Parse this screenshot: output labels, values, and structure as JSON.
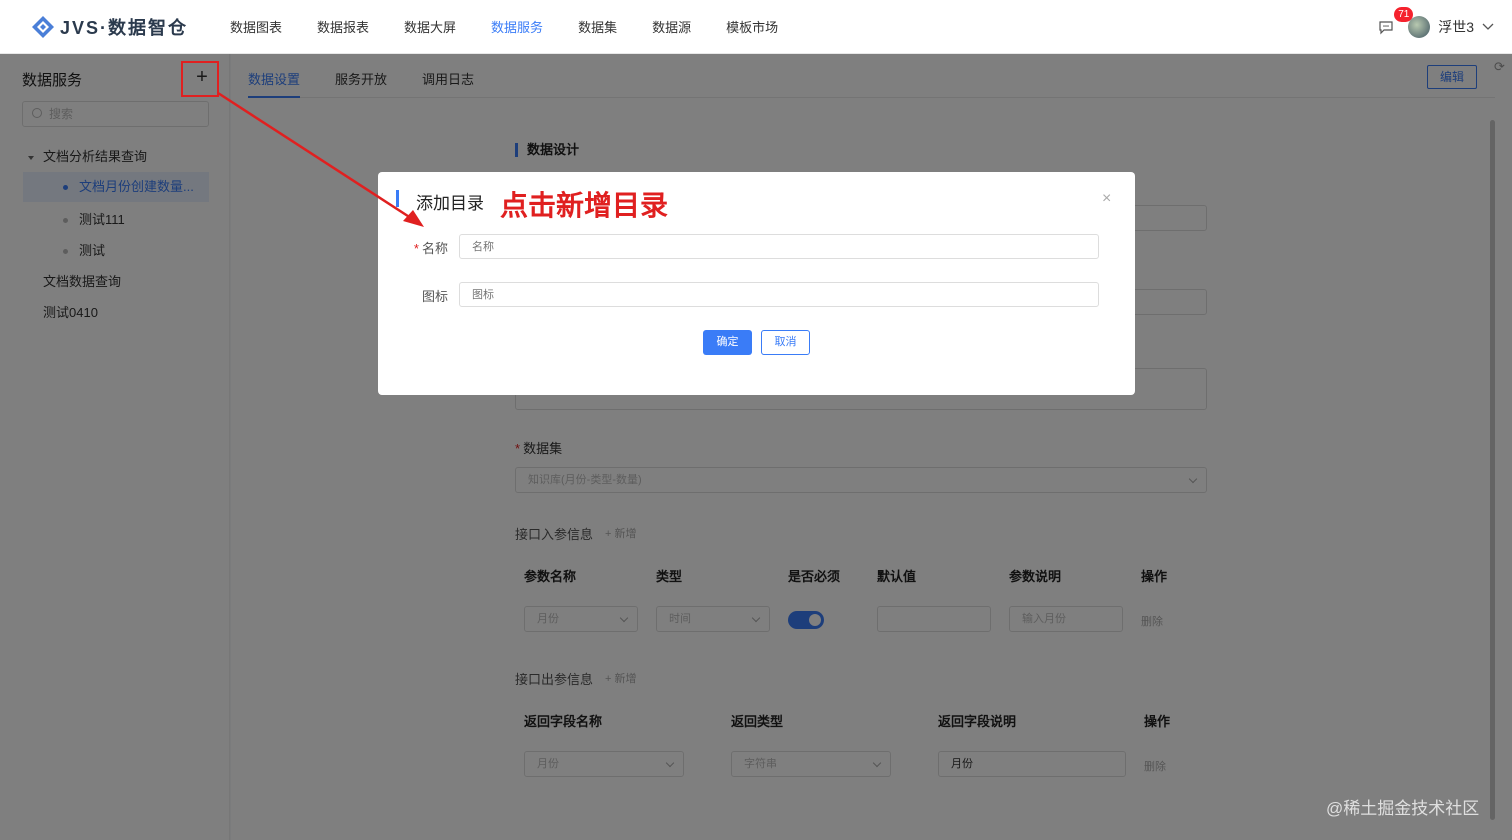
{
  "app": {
    "logo_text": "JVS·数据智仓"
  },
  "nav": {
    "items": [
      {
        "label": "数据图表",
        "active": false
      },
      {
        "label": "数据报表",
        "active": false
      },
      {
        "label": "数据大屏",
        "active": false
      },
      {
        "label": "数据服务",
        "active": true
      },
      {
        "label": "数据集",
        "active": false
      },
      {
        "label": "数据源",
        "active": false
      },
      {
        "label": "模板市场",
        "active": false
      }
    ]
  },
  "header": {
    "badge_count": "71",
    "username": "浮世3"
  },
  "sidebar": {
    "title": "数据服务",
    "add_label": "+",
    "search_placeholder": "搜索",
    "tree": [
      {
        "label": "文档分析结果查询"
      },
      {
        "label": "文档月份创建数量..."
      },
      {
        "label": "测试111"
      },
      {
        "label": "测试"
      },
      {
        "label": "文档数据查询"
      },
      {
        "label": "测试0410"
      }
    ]
  },
  "tabs": [
    {
      "label": "数据设置",
      "active": true
    },
    {
      "label": "服务开放",
      "active": false
    },
    {
      "label": "调用日志",
      "active": false
    }
  ],
  "toolbar": {
    "edit_label": "编辑"
  },
  "form": {
    "section_title": "数据设计",
    "dataset_label": "数据集",
    "dataset_value": "知识库(月份-类型-数量)",
    "input_params_label": "接口入参信息",
    "add_label": "+ 新增",
    "input_columns": [
      "参数名称",
      "类型",
      "是否必须",
      "默认值",
      "参数说明",
      "操作"
    ],
    "input_row": {
      "name": "月份",
      "type": "时间",
      "required": true,
      "default": "",
      "desc": "输入月份",
      "op": "删除"
    },
    "output_params_label": "接口出参信息",
    "output_columns": [
      "返回字段名称",
      "返回类型",
      "返回字段说明",
      "操作"
    ],
    "output_row": {
      "name": "月份",
      "type": "字符串",
      "desc": "月份",
      "op": "删除"
    }
  },
  "modal": {
    "title": "添加目录",
    "annotation": "点击新增目录",
    "name_label": "名称",
    "name_placeholder": "名称",
    "icon_label": "图标",
    "icon_placeholder": "图标",
    "ok_label": "确定",
    "cancel_label": "取消",
    "close_glyph": "×"
  },
  "watermark": "@稀土掘金技术社区",
  "colors": {
    "accent": "#3a7cf7",
    "annotation": "#e02020"
  }
}
